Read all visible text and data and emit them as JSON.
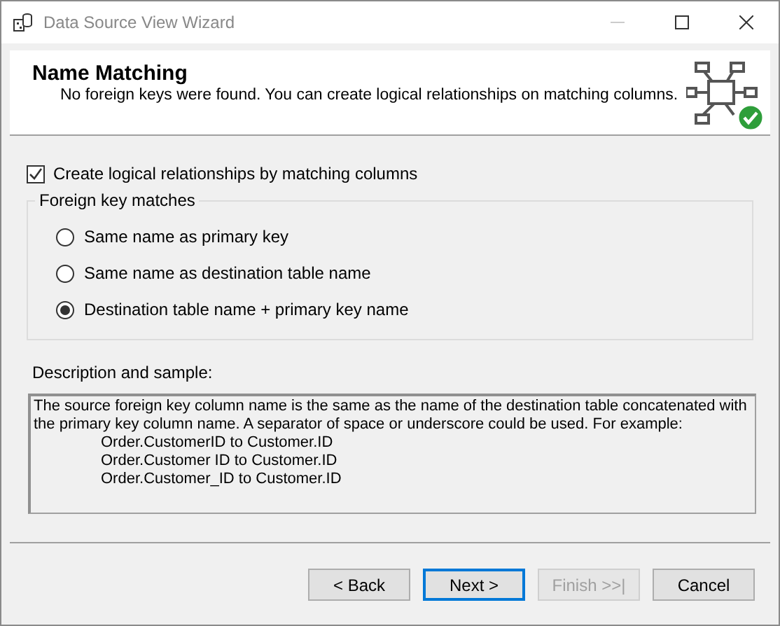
{
  "window": {
    "title": "Data Source View Wizard"
  },
  "header": {
    "title": "Name Matching",
    "subtitle": "No foreign keys were found. You can create logical relationships on matching columns."
  },
  "create_relationships": {
    "label": "Create logical relationships by matching columns",
    "checked": true
  },
  "foreign_key_matches": {
    "title": "Foreign key matches",
    "options": [
      {
        "label": "Same name as primary key",
        "selected": false
      },
      {
        "label": "Same name as destination table name",
        "selected": false
      },
      {
        "label": "Destination table name + primary key name",
        "selected": true
      }
    ]
  },
  "description": {
    "label": "Description and sample:",
    "text": "The source foreign key column name is the same as the name of the destination table concatenated with the primary key column name. A separator of space or underscore could be used. For example:",
    "examples": [
      "Order.CustomerID to Customer.ID",
      "Order.Customer ID to Customer.ID",
      "Order.Customer_ID to Customer.ID"
    ]
  },
  "buttons": [
    {
      "label": "< Back",
      "disabled": false,
      "default": false
    },
    {
      "label": "Next >",
      "disabled": false,
      "default": true
    },
    {
      "label": "Finish >>|",
      "disabled": true,
      "default": false
    },
    {
      "label": "Cancel",
      "disabled": false,
      "default": false
    }
  ]
}
